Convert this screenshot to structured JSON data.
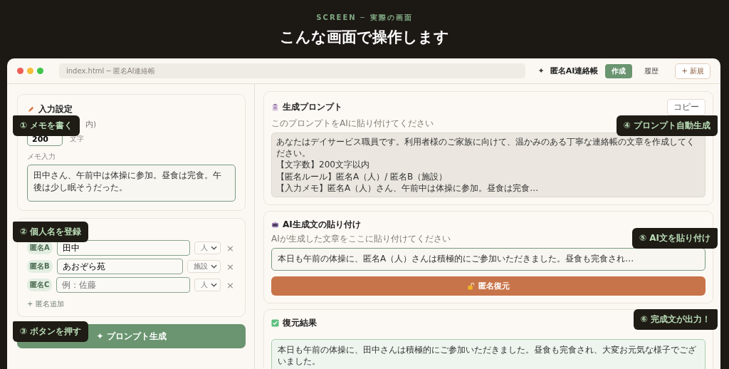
{
  "header": {
    "eyebrow": "SCREEN ─ 実際の画面",
    "title": "こんな画面で操作します"
  },
  "window": {
    "address": "index.html ─ 匿名AI連絡帳",
    "app_icon": "✦",
    "app_name": "匿名AI連絡帳",
    "tabs": [
      {
        "label": "作成",
        "selected": true
      },
      {
        "label": "履歴",
        "selected": false
      }
    ],
    "new_button": "+ 新規"
  },
  "input_card": {
    "title": "入力設定",
    "limit_label": "内)",
    "limit_value": "200",
    "limit_unit": "文字",
    "memo_label": "メモ入力",
    "memo_value": "田中さん、午前中は体操に参加。昼食は完食。午後は少し眠そうだった。"
  },
  "names_card": {
    "rows": [
      {
        "tag": "匿名A",
        "value": "田中",
        "placeholder": "",
        "type": "人",
        "remove": "×"
      },
      {
        "tag": "匿名B",
        "value": "あおぞら苑",
        "placeholder": "",
        "type": "施設",
        "remove": "×"
      },
      {
        "tag": "匿名C",
        "value": "",
        "placeholder": "例：佐藤",
        "type": "人",
        "remove": "×"
      }
    ],
    "add_link": "+ 匿名追加"
  },
  "generate_button": "✦ プロンプト生成",
  "prompt_card": {
    "title": "生成プロンプト",
    "copy": "コピー",
    "hint": "このプロンプトをAIに貼り付けてください",
    "lines": [
      "あなたはデイサービス職員です。利用者様のご家族に向けて、温かみのある丁寧な連絡帳の文章を作成してください。",
      "【文字数】200文字以内",
      "【匿名ルール】匿名A（人）/ 匿名B（施設）",
      "【入力メモ】匿名A（人）さん、午前中は体操に参加。昼食は完食…"
    ]
  },
  "paste_card": {
    "title": "AI生成文の貼り付け",
    "hint": "AIが生成した文章をここに貼り付けてください",
    "value": "本日も午前の体操に、匿名A（人）さんは積極的にご参加いただきました。昼食も完食され…",
    "button": "匿名復元"
  },
  "result_card": {
    "title": "復元結果",
    "value": "本日も午前の体操に、田中さんは積極的にご参加いただきました。昼食も完食され、大変お元気な様子でございました。"
  },
  "callouts": [
    {
      "text": "① メモを書く",
      "kind": "left"
    },
    {
      "text": "② 個人名を登録",
      "kind": "left"
    },
    {
      "text": "③ ボタンを押す",
      "kind": "left"
    },
    {
      "text": "④ プロンプト自動生成",
      "kind": "right"
    },
    {
      "text": "⑤ AI文を貼り付け",
      "kind": "right"
    },
    {
      "text": "⑥ 完成文が出力！",
      "kind": "right"
    }
  ]
}
